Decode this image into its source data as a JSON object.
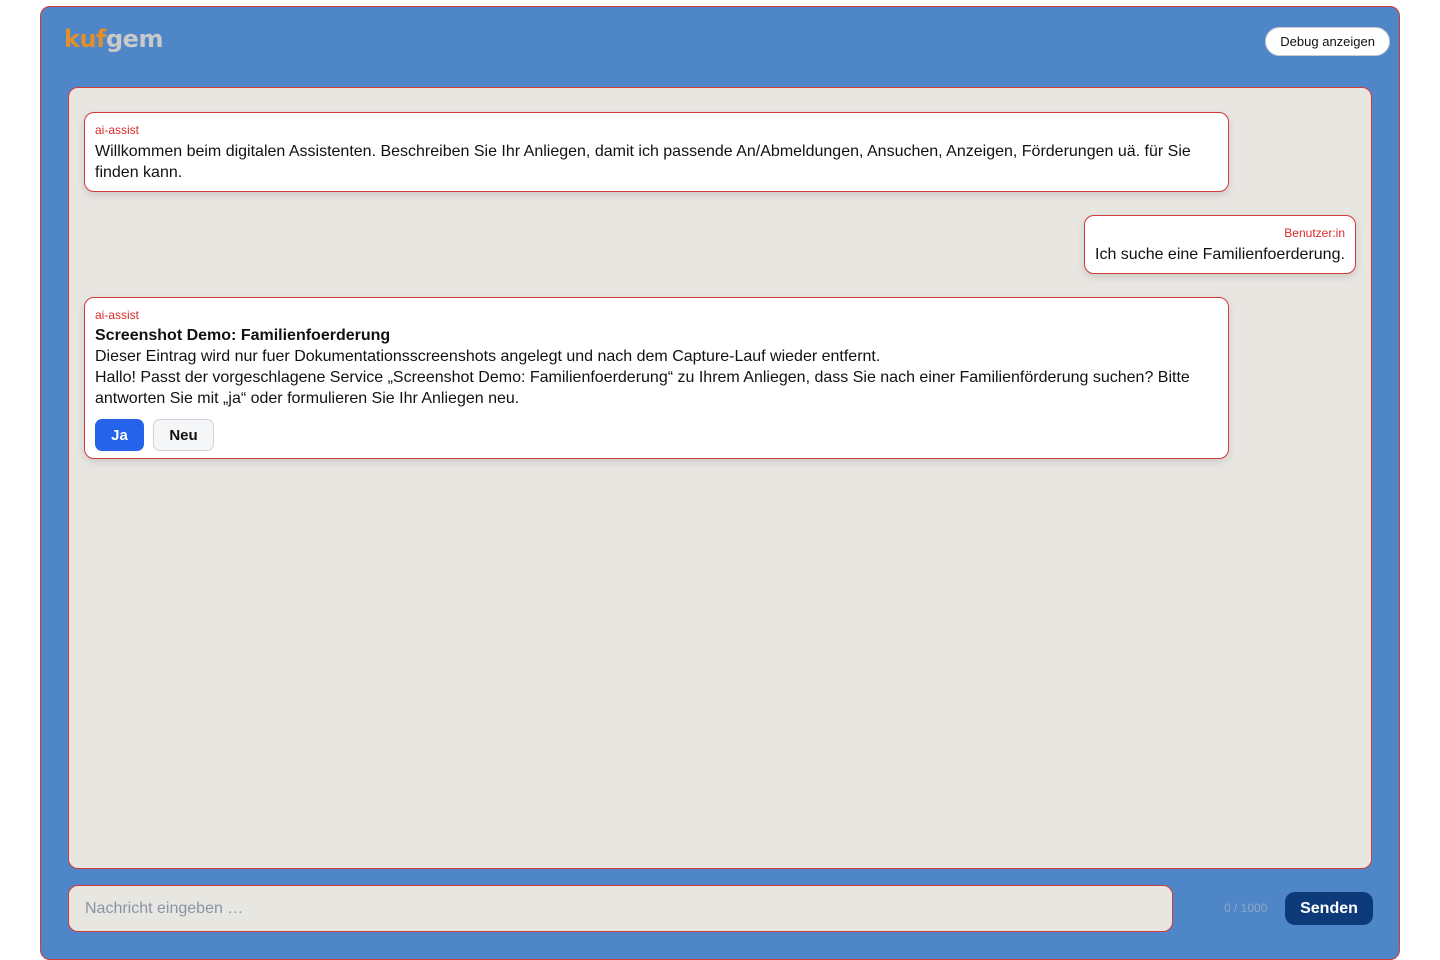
{
  "header": {
    "logo_part1": "kuf",
    "logo_part2": "gem",
    "debug_button_label": "Debug anzeigen"
  },
  "chat": {
    "messages": [
      {
        "sender": "ai-assist",
        "text": "Willkommen beim digitalen Assistenten. Beschreiben Sie Ihr Anliegen, damit ich passende An/Abmeldungen, Ansuchen, Anzeigen, Förderungen uä. für Sie finden kann."
      },
      {
        "sender": "Benutzer:in",
        "text": "Ich suche eine Familienfoerderung."
      },
      {
        "sender": "ai-assist",
        "title": "Screenshot Demo: Familienfoerderung",
        "line1": "Dieser Eintrag wird nur fuer Dokumentationsscreenshots angelegt und nach dem Capture-Lauf wieder entfernt.",
        "line2": "Hallo! Passt der vorgeschlagene Service „Screenshot Demo: Familienfoerderung“ zu Ihrem Anliegen, dass Sie nach einer Familienförderung suchen? Bitte antworten Sie mit „ja“ oder formulieren Sie Ihr Anliegen neu.",
        "buttons": {
          "yes": "Ja",
          "new": "Neu"
        }
      }
    ]
  },
  "composer": {
    "placeholder": "Nachricht eingeben …",
    "value": "",
    "counter": "0 / 1000",
    "send_label": "Senden"
  },
  "colors": {
    "frame_background": "#4f86c8",
    "accent_border": "#d33b3b",
    "chat_background": "#e8e6e1",
    "primary_button": "#2563eb",
    "send_button": "#0d3b7a",
    "logo_orange": "#e0902a",
    "logo_grey": "#c9c9c9"
  }
}
